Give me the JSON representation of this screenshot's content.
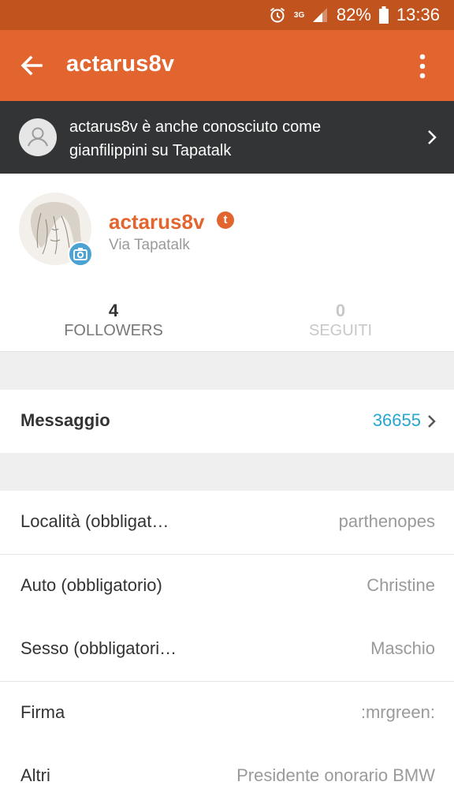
{
  "status_bar": {
    "battery": "82%",
    "time": "13:36",
    "network": "3G"
  },
  "app_bar": {
    "title": "actarus8v"
  },
  "alias_banner": {
    "text": "actarus8v è anche conosciuto come gianfilippini su Tapatalk"
  },
  "profile": {
    "username": "actarus8v",
    "badge": "t",
    "via": "Via Tapatalk",
    "followers_count": "4",
    "followers_label": "FOLLOWERS",
    "following_count": "0",
    "following_label": "SEGUITI"
  },
  "message_row": {
    "label": "Messaggio",
    "value": "36655"
  },
  "fields": [
    {
      "label": "Località (obbligat…",
      "value": "parthenopes"
    },
    {
      "label": "Auto (obbligatorio)",
      "value": "Christine"
    },
    {
      "label": "Sesso (obbligatori…",
      "value": "Maschio"
    },
    {
      "label": "Firma",
      "value": ":mrgreen:"
    },
    {
      "label": "Altri",
      "value": "Presidente onorario BMW"
    }
  ],
  "colors": {
    "app_bar": "#e2642e",
    "status_bar": "#c1531f",
    "banner": "#333435",
    "link": "#26a6d1"
  }
}
